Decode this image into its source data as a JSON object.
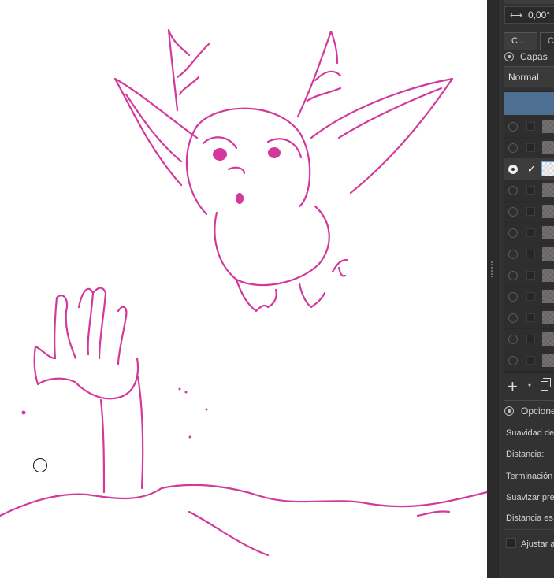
{
  "canvas": {
    "stroke_color": "#d2399a",
    "background": "#ffffff",
    "cursor": "brush-outline-circle"
  },
  "toolbox": {
    "angle_value": "0,00°",
    "angle_icon": "rotate-arrows-icon"
  },
  "docker": {
    "tabs": [
      {
        "label": "C...",
        "active": true
      },
      {
        "label": "C",
        "active": false
      }
    ],
    "layers_title": "Capas",
    "blend_mode": "Normal",
    "layers": [
      {
        "visible": false,
        "checked": false,
        "selected": false
      },
      {
        "visible": false,
        "checked": false,
        "selected": false
      },
      {
        "visible": true,
        "checked": true,
        "selected": true
      },
      {
        "visible": false,
        "checked": false,
        "selected": false
      },
      {
        "visible": false,
        "checked": false,
        "selected": false
      },
      {
        "visible": false,
        "checked": false,
        "selected": false
      },
      {
        "visible": false,
        "checked": false,
        "selected": false
      },
      {
        "visible": false,
        "checked": false,
        "selected": false
      },
      {
        "visible": false,
        "checked": false,
        "selected": false
      },
      {
        "visible": false,
        "checked": false,
        "selected": false
      },
      {
        "visible": false,
        "checked": false,
        "selected": false
      },
      {
        "visible": false,
        "checked": false,
        "selected": false
      }
    ],
    "check_mark": "✓",
    "add_label": "+",
    "add_arrow": "▾"
  },
  "options": {
    "title": "Opcione",
    "rows": [
      "Suavidad de",
      "Distancia:",
      "Terminación",
      "Suavizar pre",
      "Distancia es"
    ],
    "adjust_label": "Ajustar a"
  },
  "colors": {
    "panel_bg": "#323232",
    "accent_selected": "#4d6f91",
    "ink": "#d2399a"
  }
}
